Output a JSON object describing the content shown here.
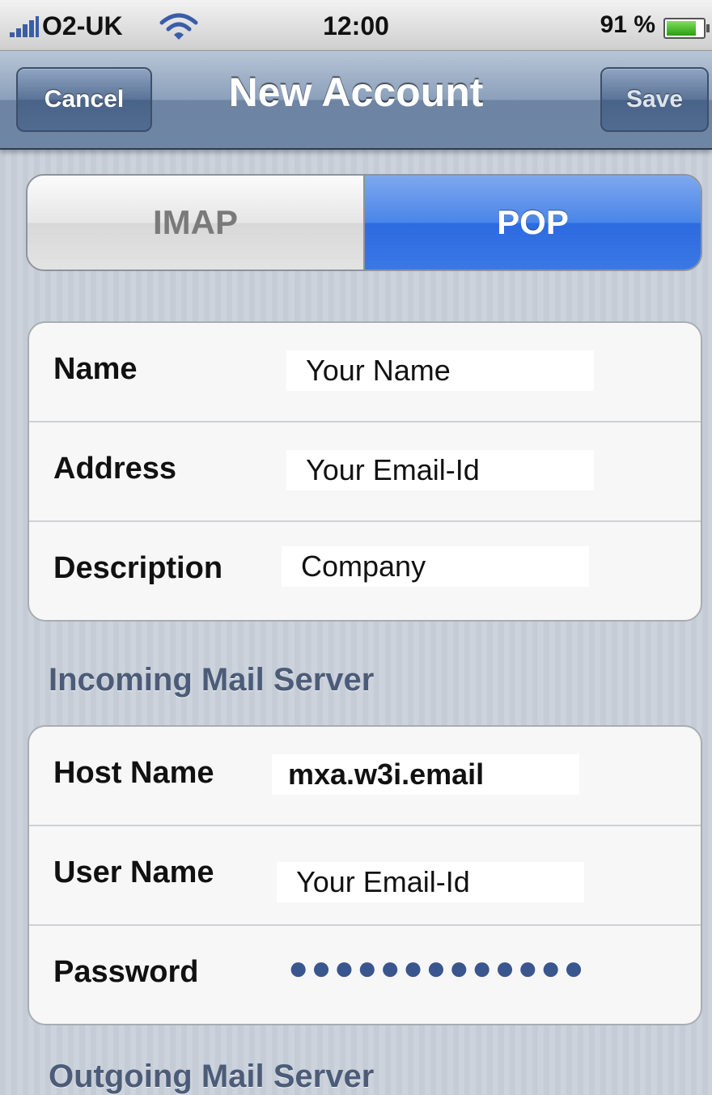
{
  "status_bar": {
    "carrier": "O2-UK",
    "time": "12:00",
    "battery": "91 %",
    "battery_level": 0.91
  },
  "nav": {
    "cancel_label": "Cancel",
    "title": "New Account",
    "save_label": "Save"
  },
  "segments": {
    "imap": "IMAP",
    "pop": "POP",
    "selected": "POP"
  },
  "account": {
    "name_label": "Name",
    "name_value": "Your Name",
    "address_label": "Address",
    "address_value": "Your Email-Id",
    "description_label": "Description",
    "description_value": "Company"
  },
  "incoming": {
    "header": "Incoming Mail Server",
    "host_label": "Host Name",
    "host_value": "mxa.w3i.email",
    "user_label": "User Name",
    "user_value": "Your Email-Id",
    "password_label": "Password",
    "password_value": "●●●●●●●●●●●●●"
  },
  "outgoing": {
    "header": "Outgoing Mail Server"
  },
  "colors": {
    "nav_blue": "#6e86a5",
    "segment_selected": "#3a78e6",
    "section_header": "#4c5c78"
  }
}
